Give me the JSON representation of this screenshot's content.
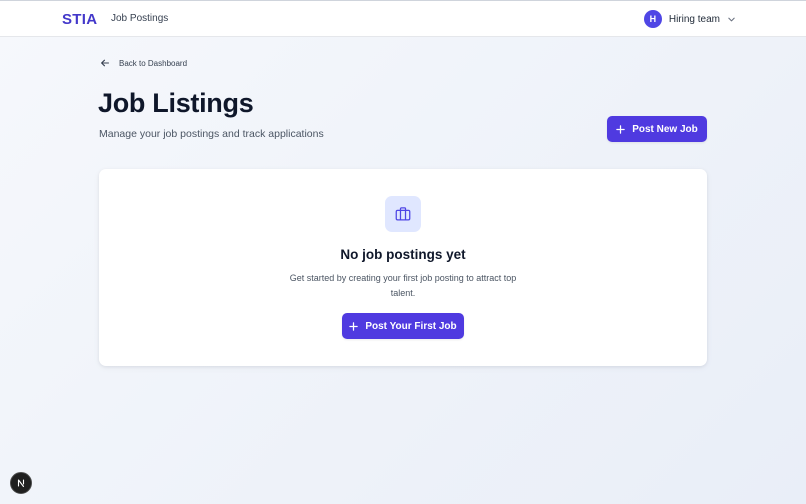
{
  "header": {
    "brand": "STIA",
    "nav_link": "Job Postings",
    "user": {
      "initial": "H",
      "name": "Hiring team"
    }
  },
  "back_link": "Back to Dashboard",
  "page": {
    "title": "Job Listings",
    "subtitle": "Manage your job postings and track applications",
    "post_new_label": "Post New Job"
  },
  "empty_state": {
    "title": "No job postings yet",
    "text": "Get started by creating your first job posting to attract top talent.",
    "cta_label": "Post Your First Job"
  },
  "colors": {
    "brand": "#4338ca",
    "primary_button": "#4f3ae0",
    "icon_bg": "#e0e7ff"
  },
  "icons": {
    "back": "arrow-left-icon",
    "plus": "plus-icon",
    "empty": "briefcase-icon",
    "user_menu": "chevron-down-icon",
    "badge": "n-logo-icon"
  }
}
